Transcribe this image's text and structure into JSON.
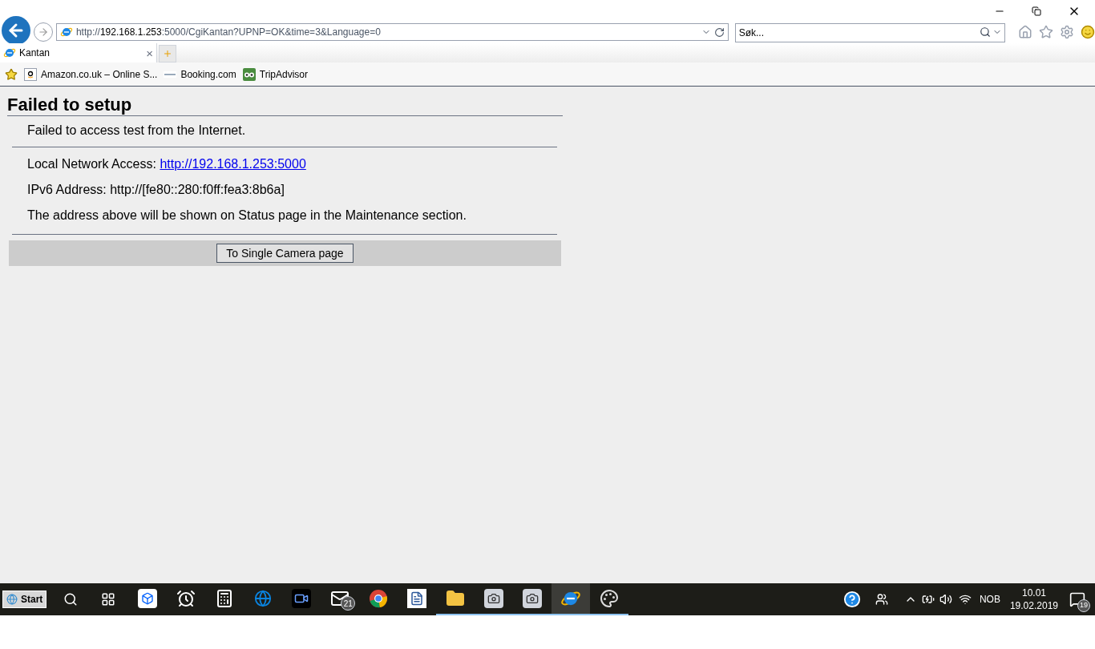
{
  "browser": {
    "url_parts": [
      {
        "text": "http://",
        "host": false
      },
      {
        "text": "192.168.1.253",
        "host": true
      },
      {
        "text": ":5000/CgiKantan?UPNP=OK&time=3&Language=0",
        "host": false
      }
    ],
    "search": {
      "placeholder": "Søk..."
    },
    "tabs": [
      {
        "label": "Kantan",
        "selected": true,
        "close": "×"
      }
    ],
    "favorites": [
      {
        "label": "Amazon.co.uk – Online S...",
        "kind": "amazon"
      },
      {
        "label": "Booking.com",
        "kind": "booking"
      },
      {
        "label": "TripAdvisor",
        "kind": "tripadvisor"
      }
    ]
  },
  "page": {
    "title": "Failed to setup",
    "message": "Failed to access test from the Internet.",
    "local_access": {
      "label": "Local Network Access: ",
      "link": "http://192.168.1.253:5000"
    },
    "ipv6": "IPv6 Address: http://[fe80::280:f0ff:fea3:8b6a]",
    "note": "The address above will be shown on Status page in the Maintenance section.",
    "button": "To Single Camera page"
  },
  "taskbar": {
    "start": "Start",
    "apps": [
      {
        "kind": "dropbox",
        "running": false,
        "selected": false
      },
      {
        "kind": "alarm",
        "running": false,
        "selected": false
      },
      {
        "kind": "calculator",
        "running": false,
        "selected": false
      },
      {
        "kind": "edge",
        "running": false,
        "selected": false
      },
      {
        "kind": "video",
        "running": false,
        "selected": false
      },
      {
        "kind": "mail",
        "running": false,
        "selected": false,
        "badge": "21"
      },
      {
        "kind": "chrome",
        "running": false,
        "selected": false
      },
      {
        "kind": "word",
        "running": false,
        "selected": false
      },
      {
        "kind": "explorer",
        "running": true,
        "selected": false
      },
      {
        "kind": "camera",
        "running": true,
        "selected": false
      },
      {
        "kind": "camera",
        "running": true,
        "selected": false
      },
      {
        "kind": "ie",
        "running": true,
        "selected": true
      },
      {
        "kind": "paint",
        "running": true,
        "selected": false
      }
    ],
    "language": "NOB",
    "time": "10.01",
    "date": "19.02.2019",
    "notifications": "19"
  }
}
